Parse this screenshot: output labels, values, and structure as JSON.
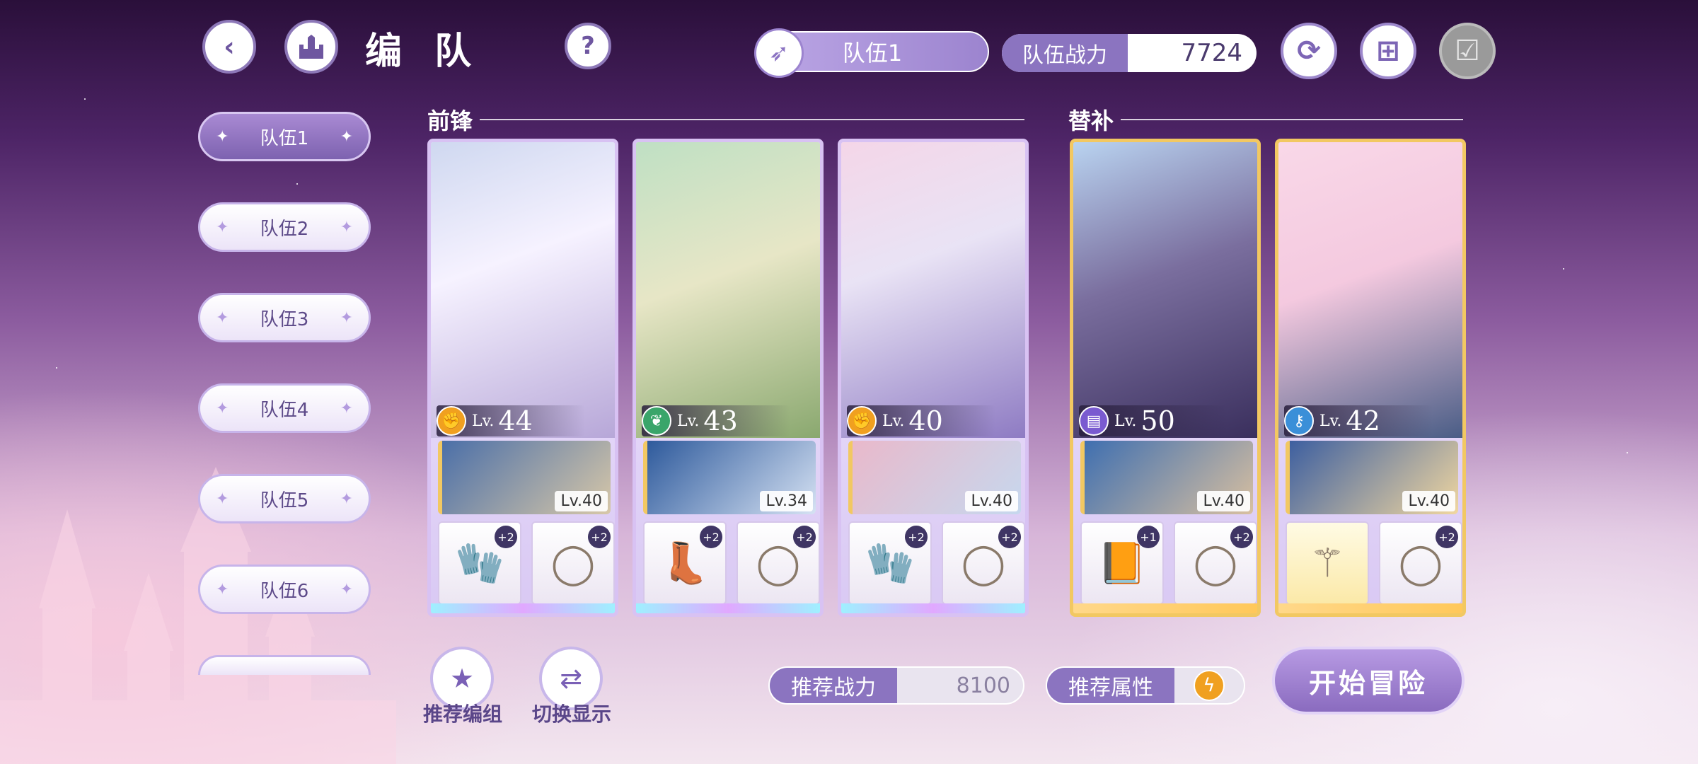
{
  "header": {
    "title": "编 队",
    "team_selector": "队伍1",
    "power_label": "队伍战力",
    "power_value": "7724"
  },
  "teams": [
    "队伍1",
    "队伍2",
    "队伍3",
    "队伍4",
    "队伍5",
    "队伍6"
  ],
  "sections": {
    "front": "前锋",
    "sub": "替补"
  },
  "cards": [
    {
      "level_prefix": "Lv.",
      "level": "44",
      "attr": "fist",
      "attr_color": "#f0a020",
      "support_level": "Lv.40",
      "equip": [
        {
          "item": "glove-blue",
          "plus": "+2"
        },
        {
          "item": "ring",
          "plus": "+2"
        }
      ]
    },
    {
      "level_prefix": "Lv.",
      "level": "43",
      "attr": "leaf",
      "attr_color": "#3aa56a",
      "support_level": "Lv.34",
      "equip": [
        {
          "item": "boot",
          "plus": "+2"
        },
        {
          "item": "ring",
          "plus": "+2"
        }
      ]
    },
    {
      "level_prefix": "Lv.",
      "level": "40",
      "attr": "fist",
      "attr_color": "#f0a020",
      "support_level": "Lv.40",
      "equip": [
        {
          "item": "glove-dark",
          "plus": "+2"
        },
        {
          "item": "ring",
          "plus": "+2"
        }
      ]
    },
    {
      "level_prefix": "Lv.",
      "level": "50",
      "attr": "book",
      "attr_color": "#7a5bd0",
      "support_level": "Lv.40",
      "equip": [
        {
          "item": "book",
          "plus": "+1"
        },
        {
          "item": "ring",
          "plus": "+2"
        }
      ]
    },
    {
      "level_prefix": "Lv.",
      "level": "42",
      "attr": "key",
      "attr_color": "#3a8fd8",
      "support_level": "Lv.40",
      "equip": [
        {
          "item": "scepter",
          "plus": ""
        },
        {
          "item": "ring",
          "plus": "+2"
        }
      ]
    }
  ],
  "bottom": {
    "recommend_team_label": "推荐编组",
    "switch_display_label": "切换显示",
    "rec_power_label": "推荐战力",
    "rec_power_value": "8100",
    "rec_attr_label": "推荐属性",
    "rec_attr_icon": "lightning-icon",
    "start_label": "开始冒险"
  }
}
